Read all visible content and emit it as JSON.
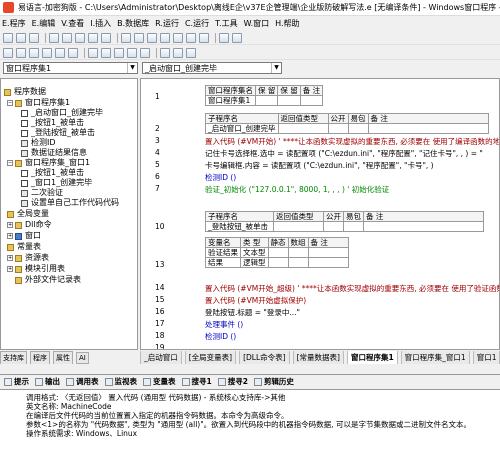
{
  "window": {
    "title": "易语言-加密狗版 - C:\\Users\\Administrator\\Desktop\\离线E企\\v37E企管理端\\企业版防破解写法.e [无编译条件] - Windows窗口程序 - [程序集: 窗口程序集1]"
  },
  "menu": [
    "E.程序",
    "E.编辑",
    "V.查看",
    "I.插入",
    "B.数据库",
    "R.运行",
    "C.运行",
    "T.工具",
    "W.窗口",
    "H.帮助"
  ],
  "selectors": {
    "left": "窗口程序集1",
    "right": "_启动窗口_创建完毕"
  },
  "tree": {
    "root": "程序数据",
    "items": [
      {
        "label": "窗口程序集1",
        "icon": "folder-icon"
      },
      {
        "label": "_启动窗口_创建完毕",
        "icon": "event-icon"
      },
      {
        "label": "_按钮1_被单击",
        "icon": "event-icon"
      },
      {
        "label": "_登陆按钮_被单击",
        "icon": "event-icon"
      },
      {
        "label": "检测ID",
        "icon": "code-icon"
      },
      {
        "label": "数据证结果信息",
        "icon": "code-icon"
      },
      {
        "label": "窗口程序集_窗口1",
        "icon": "folder-icon"
      },
      {
        "label": "_按钮1_被单击",
        "icon": "event-icon"
      },
      {
        "label": "_窗口1_创建完毕",
        "icon": "event-icon"
      },
      {
        "label": "二次验证",
        "icon": "code-icon"
      },
      {
        "label": "设置单自己工作代码代码",
        "icon": "code-icon"
      },
      {
        "label": "全局变量",
        "icon": "folder-icon"
      },
      {
        "label": "Dll命令",
        "icon": "folder-icon"
      },
      {
        "label": "窗口",
        "icon": "window-icon"
      },
      {
        "label": "常量表",
        "icon": "folder-icon"
      },
      {
        "label": "资源表",
        "icon": "folder-icon"
      },
      {
        "label": "模块引用表",
        "icon": "folder-icon"
      },
      {
        "label": "外部文件记录表",
        "icon": "folder-icon"
      }
    ]
  },
  "left_tabs": [
    "支持库",
    "程序",
    "属性",
    "AI"
  ],
  "editor": {
    "assembly_header": [
      "窗口程序集名",
      "保 留",
      "保 留",
      "备 注"
    ],
    "assembly_row": [
      "窗口程序集1",
      "",
      "",
      ""
    ],
    "sub_header": [
      "子程序名",
      "返回值类型",
      "公开",
      "易包",
      "备 注"
    ],
    "sub1_row": [
      "_启动窗口_创建完毕",
      "",
      "",
      "",
      ""
    ],
    "line_numbers": [
      "1",
      "2",
      "3",
      "4",
      "5",
      "6",
      "7",
      "8",
      "9",
      "10",
      "11",
      "12",
      "13",
      "14",
      "15",
      "16",
      "17",
      "18",
      "19"
    ],
    "code_block1": [
      "置入代码 (#VM开始) ' ****让本函数实现虚拟的重要东西, 必须要在 使用了编译函数的地方,",
      "记住卡号选择框.选中 = 读配置项 (\"C:\\ezdun.ini\", \"程序配置\", \"记住卡号\", , ) = \"",
      "卡号编辑框.内容 = 读配置项 (\"C:\\ezdun.ini\", \"程序配置\", \"卡号\", )",
      "检测ID ()",
      "验证_初始化 (\"127.0.0.1\", 8000, 1, , , ) ' 初始化验证"
    ],
    "sub2_row": [
      "_登陆按钮_被单击",
      "",
      "",
      "",
      ""
    ],
    "var_header": [
      "变量名",
      "类 型",
      "静态",
      "数组",
      "备 注"
    ],
    "vars": [
      [
        "验证结果",
        "文本型",
        "",
        "",
        ""
      ],
      [
        "结果",
        "逻辑型",
        "",
        "",
        ""
      ]
    ],
    "code_block2": [
      "置入代码 (#VM开始_超级) ' ****让本函数实现虚拟的重要东西, 必须要在 使用了验证函数的地方",
      "置入代码 (#VM开始虚拟保护)",
      "登陆按钮.标题 = \"登录中...\"",
      "处理事件 ()",
      "检测ID ()"
    ]
  },
  "bottom_tabs": [
    "_启动窗口",
    "[全局变量表]",
    "[DLL命令表]",
    "[常量数据表]",
    "窗口程序集1",
    "窗口程序集_窗口1",
    "窗口1"
  ],
  "output_tabs": [
    "提示",
    "输出",
    "调用表",
    "监视表",
    "变量表",
    "搜寻1",
    "搜寻2",
    "剪辑历史"
  ],
  "output": {
    "lines": [
      "调用格式: 〈无返回值〉 置入代码 (通用型 代码数据) - 系统核心支持库->其他",
      "英文名称: MachineCode",
      "在编译后文件代码的当前位置置入指定的机器指令码数据。本命令为高级命令。",
      "参数<1>的名称为 \"代码数据\", 类型为 \"通用型 (all)\"。欲置入到代码段中的机器指令码数据, 可以是字节集数据或二进制文件名文本。",
      "",
      "操作系统需求: Windows、Linux"
    ]
  }
}
